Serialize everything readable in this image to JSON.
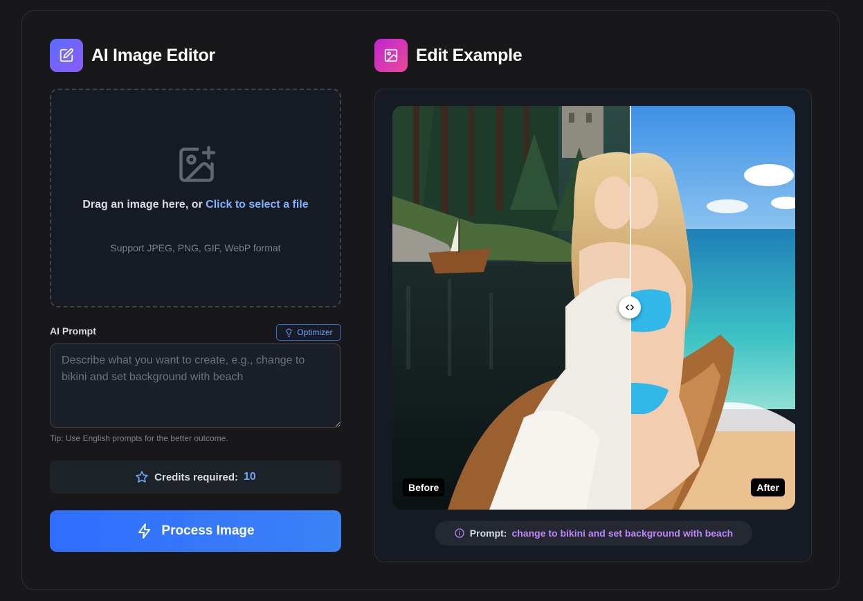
{
  "editor": {
    "title": "AI Image Editor",
    "icon": "edit-icon",
    "accent": "#7c5cff"
  },
  "upload": {
    "icon": "image-plus-icon",
    "drag_text": "Drag an image here, or ",
    "link_text": "Click to select a file",
    "formats": "Support JPEG, PNG, GIF, WebP format"
  },
  "prompt": {
    "label": "AI Prompt",
    "optimizer_label": "Optimizer",
    "optimizer_icon": "lightbulb-icon",
    "placeholder": "Describe what you want to create, e.g., change to bikini and set background with beach",
    "value": "",
    "tip": "Tip: Use English prompts for the better outcome."
  },
  "credits": {
    "icon": "star-icon",
    "label": "Credits required:",
    "value": "10"
  },
  "process": {
    "label": "Process Image",
    "icon": "lightning-icon",
    "color": "#2f6dff"
  },
  "example": {
    "title": "Edit Example",
    "icon": "image-icon",
    "accent": "#d946ef",
    "before_label": "Before",
    "after_label": "After",
    "slider_icon": "code-arrows-icon",
    "prompt_prefix": "Prompt:",
    "prompt_value": "change to bikini and set background with beach",
    "prompt_color": "#c084fc"
  }
}
